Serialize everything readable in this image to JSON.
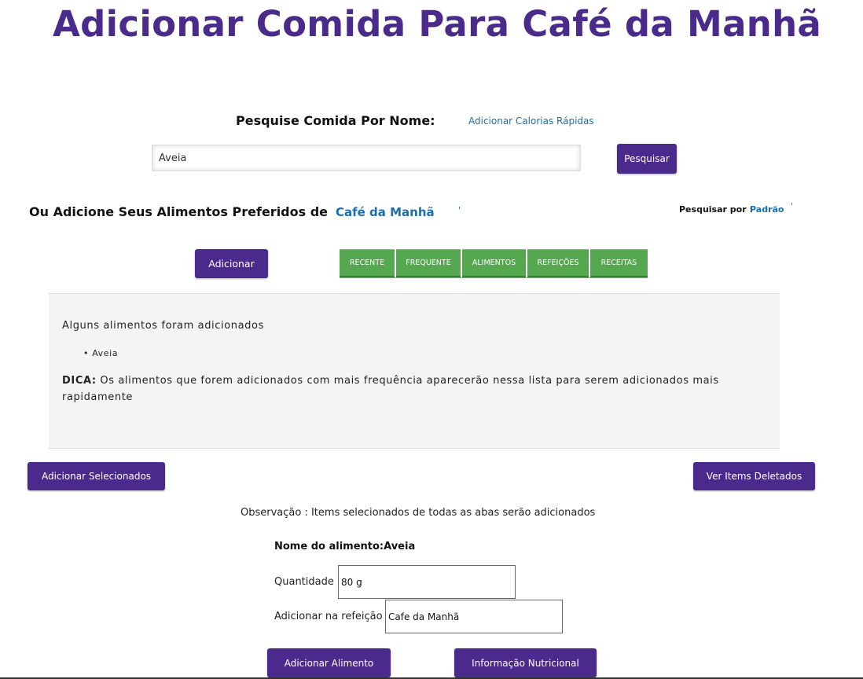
{
  "page_title": "Adicionar Comida Para Café da Manhã",
  "search": {
    "label": "Pesquise Comida Por Nome:",
    "quick_calories_link": "Adicionar Calorias Rápidas",
    "input_value": "Aveia",
    "button": "Pesquisar"
  },
  "favorites": {
    "label": "Ou Adicione Seus Alimentos Preferidos de",
    "meal_select": "Café da Manhã",
    "search_by_label": "Pesquisar por :",
    "search_by_value": "Padrão",
    "add_button": "Adicionar"
  },
  "tabs": [
    "RECENTE",
    "FREQUENTE",
    "ALIMENTOS",
    "REFEIÇÕES",
    "RECEITAS"
  ],
  "panel": {
    "message": "Alguns alimentos foram adicionados",
    "items": [
      "Aveia"
    ],
    "tip_label": "DICA:",
    "tip_line1": " Os alimentos que forem adicionados com mais frequência aparecerão nessa lista para serem adicionados mais",
    "tip_line2": "rapidamente"
  },
  "actions": {
    "add_selected": "Adicionar Selecionados",
    "view_deleted": "Ver Items Deletados",
    "note": "Observação : Items selecionados de todas as abas serão adicionados"
  },
  "food_form": {
    "food_name": "Nome do alimento:Aveia",
    "quantity_label": "Quantidade :",
    "quantity_value": "80 g",
    "meal_label": "Adicionar na refeição :",
    "meal_value": "Cafe da Manhã",
    "add_button": "Adicionar Alimento",
    "nutrition_button": "Informação Nutricional"
  },
  "colors": {
    "brand_purple": "#4a2b8c",
    "tab_green": "#55a84f",
    "link_blue": "#1a6fb0"
  }
}
